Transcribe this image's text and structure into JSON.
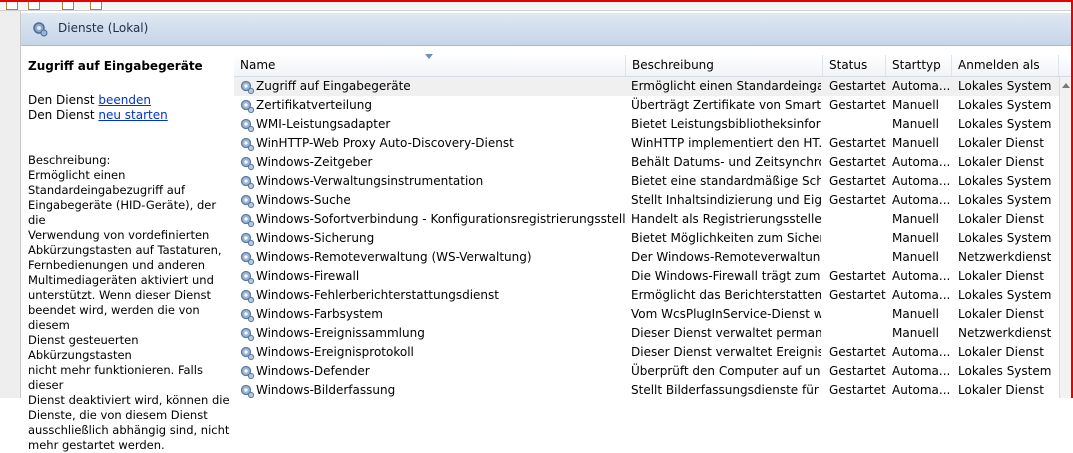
{
  "header": {
    "title": "Dienste (Lokal)"
  },
  "details": {
    "service_name": "Zugriff auf Eingabegeräte",
    "stop_prefix": "Den Dienst ",
    "stop_link": "beenden",
    "restart_prefix": "Den Dienst ",
    "restart_link": "neu starten",
    "description_label": "Beschreibung:",
    "description_text": "Ermöglicht einen\nStandardeingabezugriff auf\nEingabegeräte (HID-Geräte), der die\nVerwendung von vordefinierten\nAbkürzungstasten auf Tastaturen,\nFernbedienungen und anderen\nMultimediageräten aktiviert und\nunterstützt. Wenn dieser Dienst\nbeendet wird, werden die von diesem\nDienst gesteuerten Abkürzungstasten\nnicht mehr funktionieren. Falls dieser\nDienst deaktiviert wird, können die\nDienste, die von diesem Dienst\nausschließlich abhängig sind, nicht\nmehr gestartet werden."
  },
  "columns": {
    "name": "Name",
    "description": "Beschreibung",
    "status": "Status",
    "startup": "Starttyp",
    "logon": "Anmelden als"
  },
  "services": [
    {
      "name": "Zugriff auf Eingabegeräte",
      "description": "Ermöglicht einen Standardeingab...",
      "status": "Gestartet",
      "startup": "Automa...",
      "logon": "Lokales System"
    },
    {
      "name": "Zertifikatverteilung",
      "description": "Überträgt Zertifikate von Smartca...",
      "status": "Gestartet",
      "startup": "Manuell",
      "logon": "Lokales System"
    },
    {
      "name": "WMI-Leistungsadapter",
      "description": "Bietet Leistungsbibliotheksinform...",
      "status": "",
      "startup": "Manuell",
      "logon": "Lokales System"
    },
    {
      "name": "WinHTTP-Web Proxy Auto-Discovery-Dienst",
      "description": "WinHTTP implementiert den HT...",
      "status": "Gestartet",
      "startup": "Manuell",
      "logon": "Lokaler Dienst"
    },
    {
      "name": "Windows-Zeitgeber",
      "description": "Behält Datums- und Zeitsynchro...",
      "status": "Gestartet",
      "startup": "Automa...",
      "logon": "Lokaler Dienst"
    },
    {
      "name": "Windows-Verwaltungsinstrumentation",
      "description": "Bietet eine standardmäßige Schni...",
      "status": "Gestartet",
      "startup": "Automa...",
      "logon": "Lokales System"
    },
    {
      "name": "Windows-Suche",
      "description": "Stellt Inhaltsindizierung und Eige...",
      "status": "Gestartet",
      "startup": "Automa...",
      "logon": "Lokales System"
    },
    {
      "name": "Windows-Sofortverbindung - Konfigurationsregistrierungsstelle",
      "description": "Handelt als Registrierungsstelle u...",
      "status": "",
      "startup": "Manuell",
      "logon": "Lokaler Dienst"
    },
    {
      "name": "Windows-Sicherung",
      "description": "Bietet Möglichkeiten zum Sichern...",
      "status": "",
      "startup": "Manuell",
      "logon": "Lokales System"
    },
    {
      "name": "Windows-Remoteverwaltung (WS-Verwaltung)",
      "description": "Der Windows-Remoteverwaltungsd...",
      "status": "",
      "startup": "Manuell",
      "logon": "Netzwerkdienst"
    },
    {
      "name": "Windows-Firewall",
      "description": "Die Windows-Firewall trägt zum S...",
      "status": "Gestartet",
      "startup": "Automa...",
      "logon": "Lokaler Dienst"
    },
    {
      "name": "Windows-Fehlerberichterstattungsdienst",
      "description": "Ermöglicht das Berichterstatten ü...",
      "status": "Gestartet",
      "startup": "Automa...",
      "logon": "Lokales System"
    },
    {
      "name": "Windows-Farbsystem",
      "description": "Vom WcsPlugInService-Dienst we...",
      "status": "",
      "startup": "Manuell",
      "logon": "Lokaler Dienst"
    },
    {
      "name": "Windows-Ereignissammlung",
      "description": "Dieser Dienst verwaltet permanen...",
      "status": "",
      "startup": "Manuell",
      "logon": "Netzwerkdienst"
    },
    {
      "name": "Windows-Ereignisprotokoll",
      "description": "Dieser Dienst verwaltet Ereignisse ...",
      "status": "Gestartet",
      "startup": "Automa...",
      "logon": "Lokaler Dienst"
    },
    {
      "name": "Windows-Defender",
      "description": "Überprüft den Computer auf uner...",
      "status": "Gestartet",
      "startup": "Automa...",
      "logon": "Lokales System"
    },
    {
      "name": "Windows-Bilderfassung",
      "description": "Stellt Bilderfassungsdienste für Sc...",
      "status": "Gestartet",
      "startup": "Automa...",
      "logon": "Lokaler Dienst"
    }
  ],
  "icons": {
    "header": "services-gear-icon",
    "row": "service-gear-icon"
  },
  "colors": {
    "frame": "#e60000",
    "header_bar": "#c6d5e8",
    "link": "#0033cc",
    "selected_row": "#f0f0f0"
  }
}
